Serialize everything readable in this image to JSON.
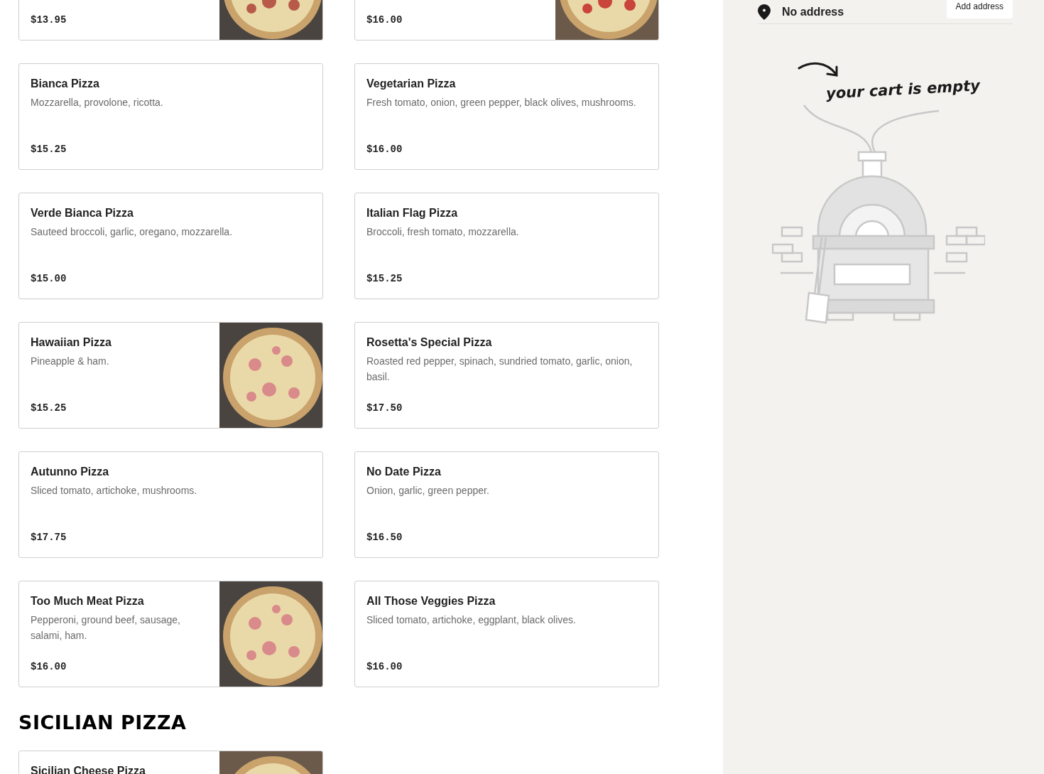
{
  "menu_items": [
    {
      "price": "$13.95"
    },
    {
      "price": "$16.00"
    },
    {
      "kind": "plain",
      "name": "Bianca Pizza",
      "description": "Mozzarella, provolone, ricotta.",
      "price": "$15.25"
    },
    {
      "kind": "plain",
      "name": "Vegetarian Pizza",
      "description": "Fresh tomato, onion, green pepper, black olives, mushrooms.",
      "price": "$16.00"
    },
    {
      "kind": "plain",
      "name": "Verde Bianca Pizza",
      "description": "Sauteed broccoli, garlic, oregano, mozzarella.",
      "price": "$15.00"
    },
    {
      "kind": "plain",
      "name": "Italian Flag Pizza",
      "description": "Broccoli, fresh tomato, mozzarella.",
      "price": "$15.25"
    },
    {
      "name": "Hawaiian Pizza",
      "description": "Pineapple & ham.",
      "price": "$15.25"
    },
    {
      "kind": "plain",
      "name": "Rosetta's Special Pizza",
      "description": "Roasted red pepper, spinach, sundried tomato, garlic, onion, basil.",
      "price": "$17.50"
    },
    {
      "kind": "plain",
      "name": "Autunno Pizza",
      "description": "Sliced tomato, artichoke, mushrooms.",
      "price": "$17.75"
    },
    {
      "kind": "plain",
      "name": "No Date Pizza",
      "description": "Onion, garlic, green pepper.",
      "price": "$16.50"
    },
    {
      "name": "Too Much Meat Pizza",
      "description": "Pepperoni, ground beef, sausage, salami, ham.",
      "price": "$16.00"
    },
    {
      "kind": "plain",
      "name": "All Those Veggies Pizza",
      "description": "Sliced tomato, artichoke, eggplant, black olives.",
      "price": "$16.00"
    }
  ],
  "section": {
    "title": "SICILIAN PIZZA",
    "items": [
      {
        "name": "Sicilian Cheese Pizza"
      }
    ]
  },
  "cart": {
    "address": "No address",
    "add_address_button": "Add address",
    "empty_message": "your cart is empty"
  }
}
